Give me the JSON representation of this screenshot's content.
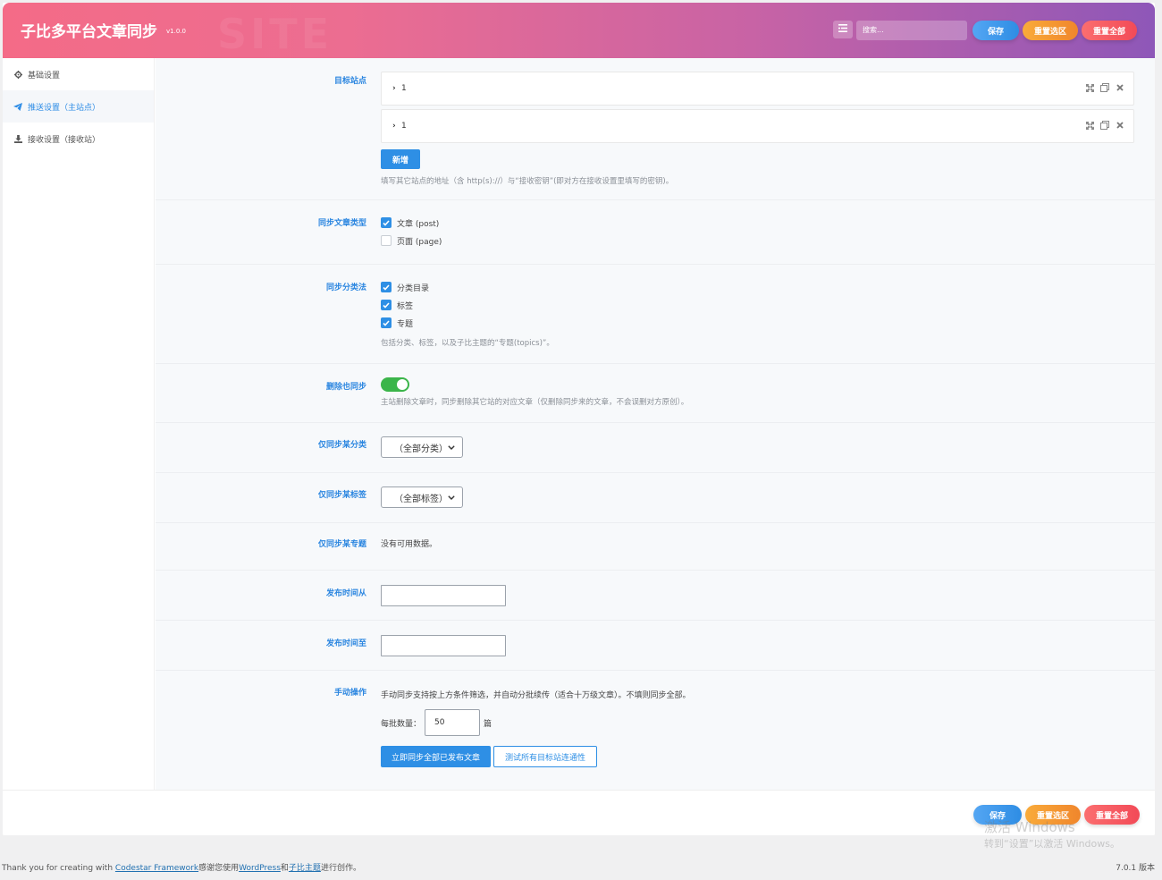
{
  "header": {
    "title": "子比多平台文章同步",
    "version": "v1.0.0",
    "search_placeholder": "搜索...",
    "save": "保存",
    "reset_section": "重置选区",
    "reset_all": "重置全部",
    "watermark_text": "SITE"
  },
  "sidebar": {
    "items": [
      {
        "label": "基础设置",
        "icon": "gear-icon"
      },
      {
        "label": "推送设置（主站点）",
        "icon": "paper-plane-icon",
        "active": true
      },
      {
        "label": "接收设置（接收站）",
        "icon": "download-icon"
      }
    ]
  },
  "fields": {
    "target_sites": {
      "label": "目标站点",
      "items": [
        {
          "title": "1"
        },
        {
          "title": "1"
        }
      ],
      "add_button": "新增",
      "help": "填写其它站点的地址（含 http(s)://）与“接收密钥”(即对方在接收设置里填写的密钥)。"
    },
    "post_types": {
      "label": "同步文章类型",
      "options": [
        {
          "label": "文章 (post)",
          "checked": true
        },
        {
          "label": "页面 (page)",
          "checked": false
        }
      ]
    },
    "taxonomies": {
      "label": "同步分类法",
      "options": [
        {
          "label": "分类目录",
          "checked": true
        },
        {
          "label": "标签",
          "checked": true
        },
        {
          "label": "专题",
          "checked": true
        }
      ],
      "help": "包括分类、标签，以及子比主题的“专题(topics)”。"
    },
    "delete_sync": {
      "label": "删除也同步",
      "enabled": true,
      "help": "主站删除文章时，同步删除其它站的对应文章（仅删除同步来的文章，不会误删对方原创）。"
    },
    "only_category": {
      "label": "仅同步某分类",
      "value": "（全部分类）"
    },
    "only_tag": {
      "label": "仅同步某标签",
      "value": "（全部标签）"
    },
    "only_topic": {
      "label": "仅同步某专题",
      "value": "没有可用数据。"
    },
    "date_from": {
      "label": "发布时间从",
      "value": ""
    },
    "date_to": {
      "label": "发布时间至",
      "value": ""
    },
    "manual": {
      "label": "手动操作",
      "description": "手动同步支持按上方条件筛选，并自动分批续传（适合十万级文章）。不填则同步全部。",
      "batch_label": "每批数量：",
      "batch_value": "50",
      "batch_unit": "篇",
      "sync_button": "立即同步全部已发布文章",
      "test_button": "测试所有目标站连通性"
    }
  },
  "footer": {
    "save": "保存",
    "reset_section": "重置选区",
    "reset_all": "重置全部",
    "activate_line1": "激活 Windows",
    "activate_line2": "转到“设置”以激活 Windows。",
    "credits_prefix": "Thank you for creating with ",
    "credits_link1": "Codestar Framework",
    "credits_mid1": "感谢您使用",
    "credits_link2": "WordPress",
    "credits_mid2": "和",
    "credits_link3": "子比主题",
    "credits_suffix": "进行创作。",
    "version": "7.0.1 版本"
  },
  "colors": {
    "accent": "#2e8fe5",
    "label": "#2b86e0",
    "toggle_on": "#3bb54a",
    "header_start": "#f46b87",
    "header_end": "#8e57b8"
  }
}
